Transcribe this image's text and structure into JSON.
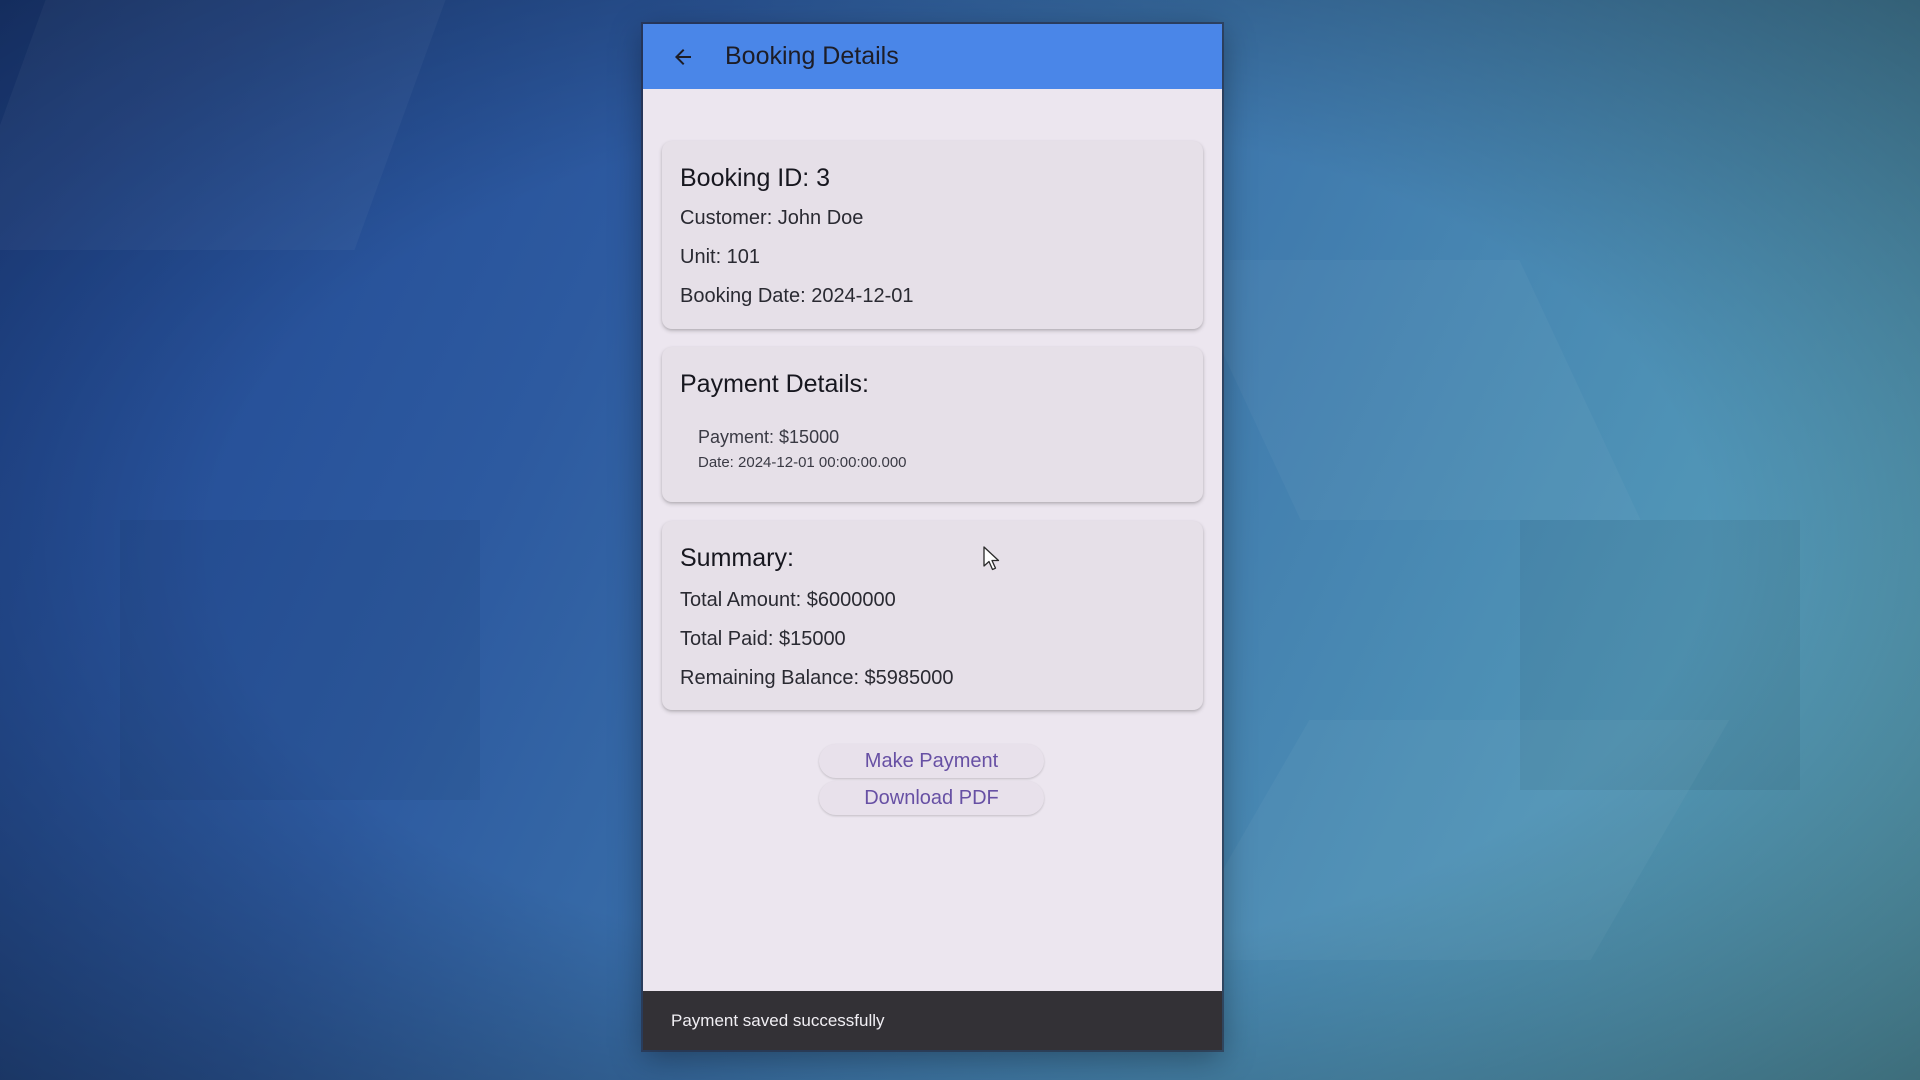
{
  "app_bar": {
    "back_icon": "arrow-left-icon",
    "title": "Booking Details"
  },
  "booking_card": {
    "title": "Booking ID: 3",
    "customer": "Customer: John Doe",
    "unit": "Unit: 101",
    "booking_date": "Booking Date: 2024-12-01"
  },
  "payment_card": {
    "title": "Payment Details:",
    "payments": [
      {
        "amount": "Payment: $15000",
        "date": "Date: 2024-12-01 00:00:00.000"
      }
    ]
  },
  "summary_card": {
    "title": "Summary:",
    "total_amount": "Total Amount: $6000000",
    "total_paid": "Total Paid: $15000",
    "remaining_balance": "Remaining Balance: $5985000"
  },
  "actions": {
    "make_payment_label": "Make Payment",
    "download_pdf_label": "Download PDF"
  },
  "snackbar": {
    "message": "Payment saved successfully"
  },
  "colors": {
    "app_bar": "#4a86e8",
    "surface": "#ece6ef",
    "card": "#e6e0e8",
    "button_text": "#6750a4",
    "snackbar": "#333136"
  }
}
